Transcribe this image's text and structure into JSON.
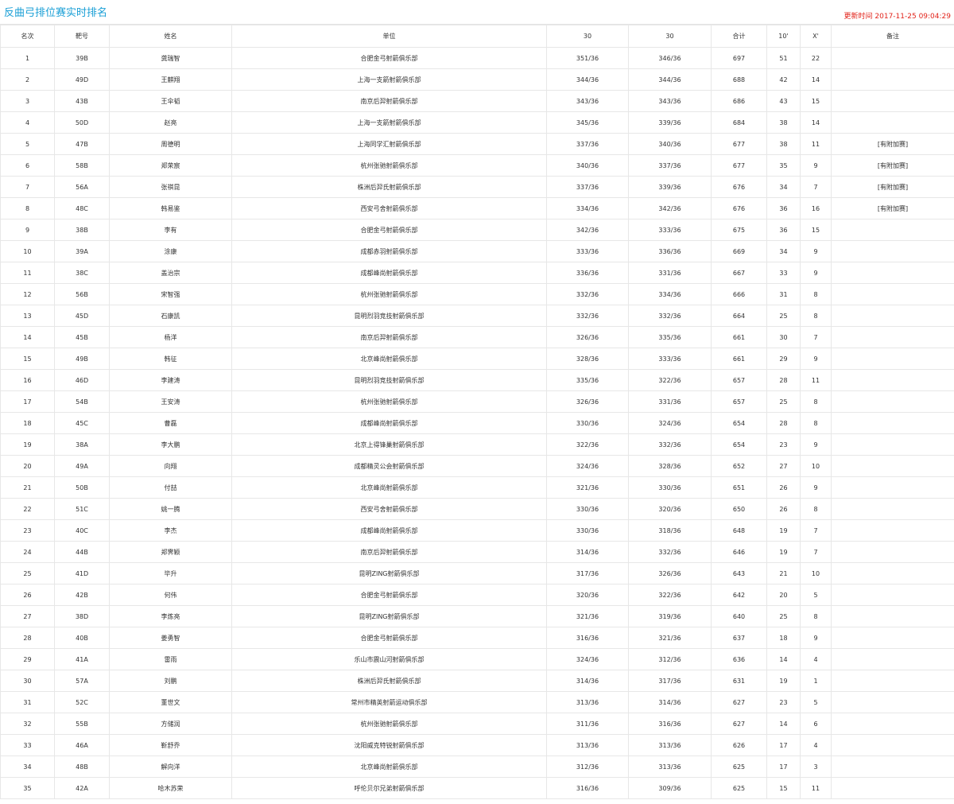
{
  "page": {
    "title": "反曲弓排位赛实时排名",
    "update_label": "更新时间",
    "update_time": "2017-11-25 09:04:29"
  },
  "table": {
    "headers": [
      "名次",
      "靶号",
      "姓名",
      "单位",
      "30",
      "30",
      "合计",
      "10'",
      "X'",
      "备注"
    ],
    "rows": [
      [
        "1",
        "39B",
        "龚瑞智",
        "合肥金弓射箭俱乐部",
        "351/36",
        "346/36",
        "697",
        "51",
        "22",
        ""
      ],
      [
        "2",
        "49D",
        "王麒翔",
        "上海一支箭射箭俱乐部",
        "344/36",
        "344/36",
        "688",
        "42",
        "14",
        ""
      ],
      [
        "3",
        "43B",
        "王伞韬",
        "南京后羿射箭俱乐部",
        "343/36",
        "343/36",
        "686",
        "43",
        "15",
        ""
      ],
      [
        "4",
        "50D",
        "赵亮",
        "上海一支箭射箭俱乐部",
        "345/36",
        "339/36",
        "684",
        "38",
        "14",
        ""
      ],
      [
        "5",
        "47B",
        "周德明",
        "上海同学汇射箭俱乐部",
        "337/36",
        "340/36",
        "677",
        "38",
        "11",
        "[有附加赛]"
      ],
      [
        "6",
        "58B",
        "郑荣宸",
        "杭州张驰射箭俱乐部",
        "340/36",
        "337/36",
        "677",
        "35",
        "9",
        "[有附加赛]"
      ],
      [
        "7",
        "56A",
        "张祺昆",
        "株洲后羿氏射箭俱乐部",
        "337/36",
        "339/36",
        "676",
        "34",
        "7",
        "[有附加赛]"
      ],
      [
        "8",
        "48C",
        "韩易鉴",
        "西安弓舍射箭俱乐部",
        "334/36",
        "342/36",
        "676",
        "36",
        "16",
        "[有附加赛]"
      ],
      [
        "9",
        "38B",
        "李有",
        "合肥金弓射箭俱乐部",
        "342/36",
        "333/36",
        "675",
        "36",
        "15",
        ""
      ],
      [
        "10",
        "39A",
        "涂康",
        "成都赤羽射箭俱乐部",
        "333/36",
        "336/36",
        "669",
        "34",
        "9",
        ""
      ],
      [
        "11",
        "38C",
        "盖治宗",
        "成都峰尚射箭俱乐部",
        "336/36",
        "331/36",
        "667",
        "33",
        "9",
        ""
      ],
      [
        "12",
        "56B",
        "宋智强",
        "杭州张驰射箭俱乐部",
        "332/36",
        "334/36",
        "666",
        "31",
        "8",
        ""
      ],
      [
        "13",
        "45D",
        "石康凯",
        "昆明烈羽竞技射箭俱乐部",
        "332/36",
        "332/36",
        "664",
        "25",
        "8",
        ""
      ],
      [
        "14",
        "45B",
        "杨洋",
        "南京后羿射箭俱乐部",
        "326/36",
        "335/36",
        "661",
        "30",
        "7",
        ""
      ],
      [
        "15",
        "49B",
        "韩征",
        "北京峰尚射箭俱乐部",
        "328/36",
        "333/36",
        "661",
        "29",
        "9",
        ""
      ],
      [
        "16",
        "46D",
        "李建涛",
        "昆明烈羽竞技射箭俱乐部",
        "335/36",
        "322/36",
        "657",
        "28",
        "11",
        ""
      ],
      [
        "17",
        "54B",
        "王安涛",
        "杭州张驰射箭俱乐部",
        "326/36",
        "331/36",
        "657",
        "25",
        "8",
        ""
      ],
      [
        "18",
        "45C",
        "曹磊",
        "成都峰尚射箭俱乐部",
        "330/36",
        "324/36",
        "654",
        "28",
        "8",
        ""
      ],
      [
        "19",
        "38A",
        "李大鹏",
        "北京上得锋巢射箭俱乐部",
        "322/36",
        "332/36",
        "654",
        "23",
        "9",
        ""
      ],
      [
        "20",
        "49A",
        "向翔",
        "成都精灵公会射箭俱乐部",
        "324/36",
        "328/36",
        "652",
        "27",
        "10",
        ""
      ],
      [
        "21",
        "50B",
        "付喆",
        "北京峰尚射箭俱乐部",
        "321/36",
        "330/36",
        "651",
        "26",
        "9",
        ""
      ],
      [
        "22",
        "51C",
        "姚一腾",
        "西安弓舍射箭俱乐部",
        "330/36",
        "320/36",
        "650",
        "26",
        "8",
        ""
      ],
      [
        "23",
        "40C",
        "李杰",
        "成都峰尚射箭俱乐部",
        "330/36",
        "318/36",
        "648",
        "19",
        "7",
        ""
      ],
      [
        "24",
        "44B",
        "郑霁颖",
        "南京后羿射箭俱乐部",
        "314/36",
        "332/36",
        "646",
        "19",
        "7",
        ""
      ],
      [
        "25",
        "41D",
        "毕升",
        "昆明ZING射箭俱乐部",
        "317/36",
        "326/36",
        "643",
        "21",
        "10",
        ""
      ],
      [
        "26",
        "42B",
        "何伟",
        "合肥金弓射箭俱乐部",
        "320/36",
        "322/36",
        "642",
        "20",
        "5",
        ""
      ],
      [
        "27",
        "38D",
        "李炼亮",
        "昆明ZING射箭俱乐部",
        "321/36",
        "319/36",
        "640",
        "25",
        "8",
        ""
      ],
      [
        "28",
        "40B",
        "姜勇智",
        "合肥金弓射箭俱乐部",
        "316/36",
        "321/36",
        "637",
        "18",
        "9",
        ""
      ],
      [
        "29",
        "41A",
        "雷雨",
        "乐山市震山河射箭俱乐部",
        "324/36",
        "312/36",
        "636",
        "14",
        "4",
        ""
      ],
      [
        "30",
        "57A",
        "刘鹏",
        "株洲后羿氏射箭俱乐部",
        "314/36",
        "317/36",
        "631",
        "19",
        "1",
        ""
      ],
      [
        "31",
        "52C",
        "董世文",
        "常州市精英射箭运动俱乐部",
        "313/36",
        "314/36",
        "627",
        "23",
        "5",
        ""
      ],
      [
        "32",
        "55B",
        "方储润",
        "杭州张驰射箭俱乐部",
        "311/36",
        "316/36",
        "627",
        "14",
        "6",
        ""
      ],
      [
        "33",
        "46A",
        "靳舒乔",
        "沈阳威克特锐射箭俱乐部",
        "313/36",
        "313/36",
        "626",
        "17",
        "4",
        ""
      ],
      [
        "34",
        "48B",
        "解向洋",
        "北京峰尚射箭俱乐部",
        "312/36",
        "313/36",
        "625",
        "17",
        "3",
        ""
      ],
      [
        "35",
        "42A",
        "哈木苏荣",
        "呼伦贝尔兄弟射箭俱乐部",
        "316/36",
        "309/36",
        "625",
        "15",
        "11",
        ""
      ]
    ]
  }
}
